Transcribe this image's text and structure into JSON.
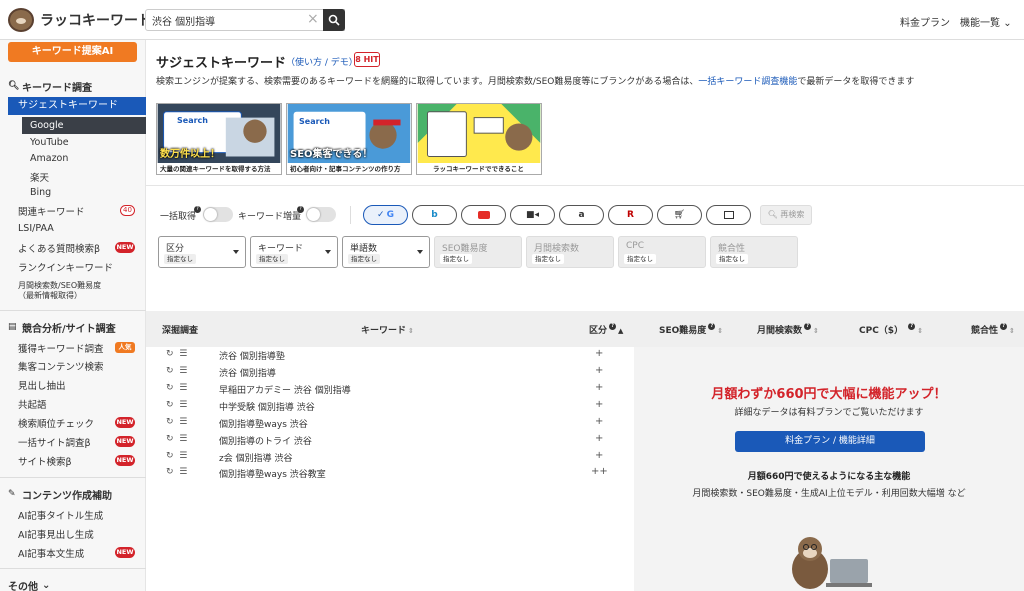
{
  "header": {
    "logo_text": "ラッコキーワード",
    "search_value": "渋谷 個別指導",
    "pricing_label": "料金プラン",
    "features_label": "機能一覧"
  },
  "sidebar": {
    "ai_button": "キーワード提案AI",
    "section_keyword": "キーワード調査",
    "suggest": "サジェストキーワード",
    "sources": [
      "Google",
      "YouTube",
      "Amazon",
      "楽天",
      "Bing"
    ],
    "related": "関連キーワード",
    "related_count": "40",
    "lsi": "LSI/PAA",
    "faq": "よくある質問検索β",
    "rankin": "ランクインキーワード",
    "volume_line1": "月間検索数/SEO難易度",
    "volume_line2": "（最新情報取得）",
    "section_competitor": "競合分析/サイト調査",
    "acquired": "獲得キーワード調査",
    "popular_badge": "人気",
    "attract": "集客コンテンツ検索",
    "headings": "見出し抽出",
    "cooccur": "共起語",
    "rank_check": "検索順位チェック",
    "bulk_site": "一括サイト調査β",
    "site_search": "サイト検索β",
    "section_content": "コンテンツ作成補助",
    "ai_title": "AI記事タイトル生成",
    "ai_heading": "AI記事見出し生成",
    "ai_body": "AI記事本文生成",
    "new_badge": "NEW",
    "other": "その他"
  },
  "main": {
    "title": "サジェストキーワード",
    "howto": "（使い方 / デモ）",
    "hit_badge": "8 HIT",
    "desc_before": "検索エンジンが提案する、検索需要のあるキーワードを網羅的に取得しています。月間検索数/SEO難易度等にブランクがある場合は、",
    "desc_link": "一括キーワード調査機能",
    "desc_after": "で最新データを取得できます",
    "banners": [
      {
        "top": "Search",
        "caption": "数万件以上！",
        "strip": "大量の関連キーワードを取得する方法"
      },
      {
        "top": "Search",
        "caption": "SEO集客できる！",
        "strip": "初心者向け・記事コンテンツの作り方"
      },
      {
        "top": "",
        "caption": "",
        "strip": "ラッコキーワードでできること"
      }
    ],
    "toggle_bulk": "一括取得",
    "toggle_increase": "キーワード増量",
    "research": "再検索",
    "filters": [
      {
        "label": "区分",
        "value": "指定なし"
      },
      {
        "label": "キーワード",
        "value": "指定なし"
      },
      {
        "label": "単語数",
        "value": "指定なし"
      },
      {
        "label": "SEO難易度",
        "value": "指定なし"
      },
      {
        "label": "月間検索数",
        "value": "指定なし"
      },
      {
        "label": "CPC",
        "value": "指定なし"
      },
      {
        "label": "競合性",
        "value": "指定なし"
      }
    ],
    "columns": {
      "deep": "深掘調査",
      "keyword": "キーワード",
      "category": "区分",
      "seo": "SEO難易度",
      "volume": "月間検索数",
      "cpc": "CPC（$）",
      "competition": "競合性"
    },
    "rows": [
      {
        "keyword": "渋谷 個別指導塾",
        "cat": "+"
      },
      {
        "keyword": "渋谷 個別指導",
        "cat": "+"
      },
      {
        "keyword": "早稲田アカデミー 渋谷 個別指導",
        "cat": "+"
      },
      {
        "keyword": "中学受験 個別指導 渋谷",
        "cat": "+"
      },
      {
        "keyword": "個別指導塾ways 渋谷",
        "cat": "+"
      },
      {
        "keyword": "個別指導のトライ 渋谷",
        "cat": "+"
      },
      {
        "keyword": "z会 個別指導 渋谷",
        "cat": "+"
      },
      {
        "keyword": "個別指導塾ways 渋谷教室",
        "cat": "++"
      }
    ],
    "promo": {
      "title": "月額わずか660円で大幅に機能アップ！",
      "sub": "詳細なデータは有料プランでご覧いただけます",
      "button": "料金プラン / 機能詳細",
      "heading": "月額660円で使えるようになる主な機能",
      "features": "月間検索数・SEO難易度・生成AI上位モデル・利用回数大幅増 など"
    }
  },
  "colors": {
    "accent_blue": "#1a59b8",
    "orange": "#f07a22",
    "red": "#d3232a"
  }
}
